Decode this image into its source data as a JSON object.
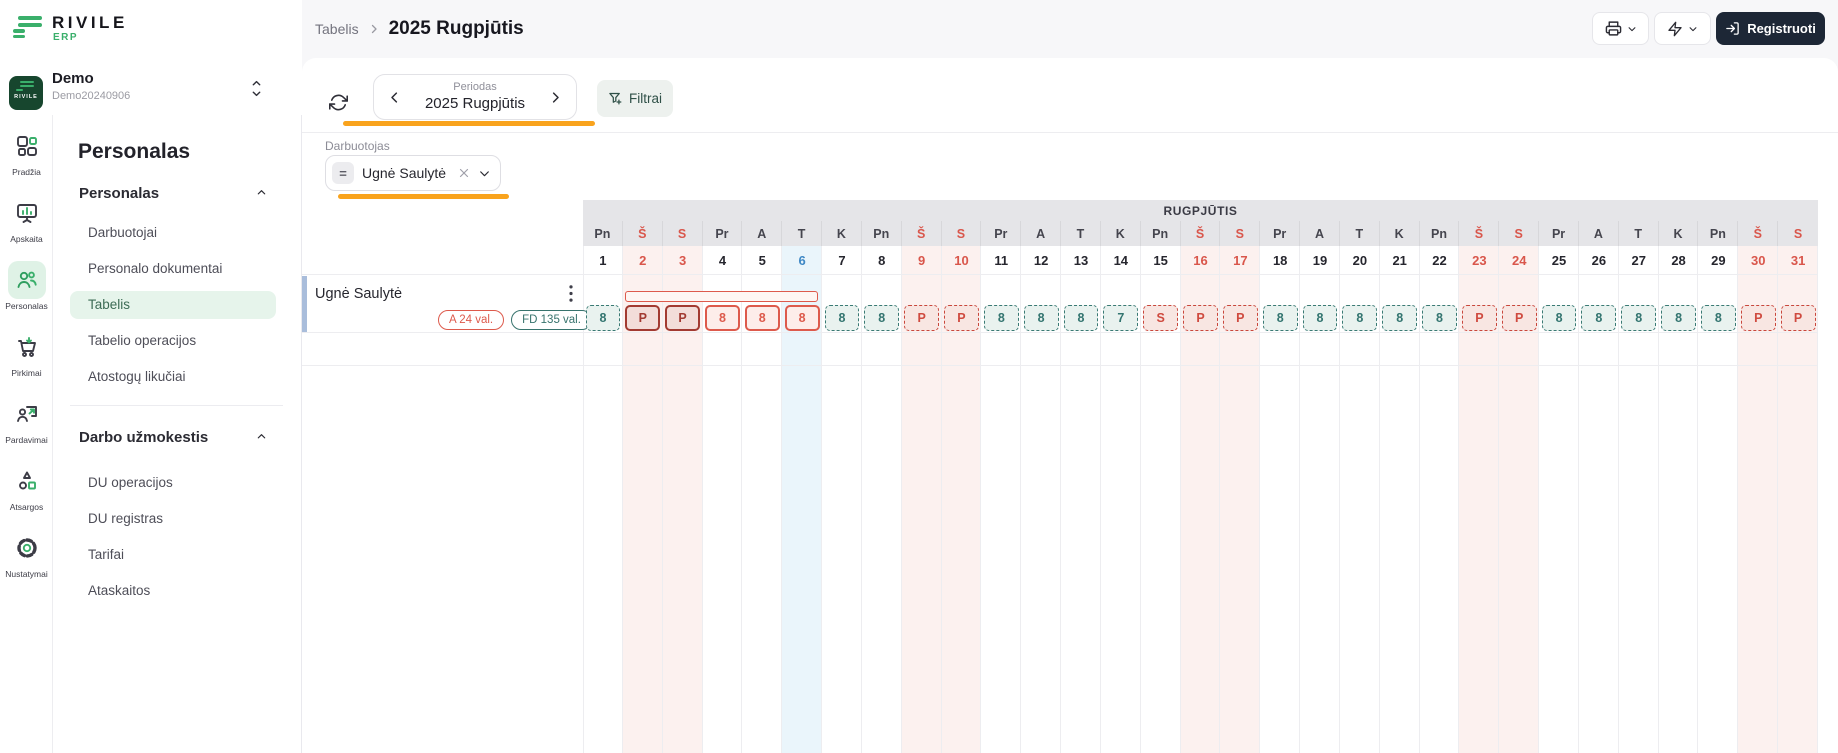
{
  "brand": {
    "name": "RIVILE",
    "tagline": "ERP"
  },
  "workspace": {
    "name": "Demo",
    "code": "Demo20240906"
  },
  "nav_rail": {
    "items": [
      {
        "label": "Pradžia",
        "active": false
      },
      {
        "label": "Apskaita",
        "active": false
      },
      {
        "label": "Personalas",
        "active": true
      },
      {
        "label": "Pirkimai",
        "active": false
      },
      {
        "label": "Pardavimai",
        "active": false
      },
      {
        "label": "Atsargos",
        "active": false
      },
      {
        "label": "Nustatymai",
        "active": false
      }
    ]
  },
  "sidebar": {
    "title": "Personalas",
    "sections": [
      {
        "label": "Personalas",
        "items": [
          {
            "label": "Darbuotojai",
            "active": false
          },
          {
            "label": "Personalo dokumentai",
            "active": false
          },
          {
            "label": "Tabelis",
            "active": true
          },
          {
            "label": "Tabelio operacijos",
            "active": false
          },
          {
            "label": "Atostogų likučiai",
            "active": false
          }
        ]
      },
      {
        "label": "Darbo užmokestis",
        "items": [
          {
            "label": "DU operacijos",
            "active": false
          },
          {
            "label": "DU registras",
            "active": false
          },
          {
            "label": "Tarifai",
            "active": false
          },
          {
            "label": "Ataskaitos",
            "active": false
          }
        ]
      }
    ]
  },
  "topbar": {
    "breadcrumb_parent": "Tabelis",
    "breadcrumb_current": "2025 Rugpjūtis",
    "register_label": "Registruoti"
  },
  "toolbar": {
    "period_label": "Periodas",
    "period_value": "2025 Rugpjūtis",
    "filter_button": "Filtrai"
  },
  "employee_filter": {
    "label": "Darbuotojas",
    "value": "Ugnė Saulytė"
  },
  "timesheet": {
    "month_title": "RUGPJŪTIS",
    "employee": {
      "name": "Ugnė Saulytė",
      "badges": [
        {
          "label": "A 24 val.",
          "style": "red"
        },
        {
          "label": "FD 135 val.",
          "style": "teal"
        }
      ]
    },
    "selection": {
      "from_day": 2,
      "to_day": 6
    },
    "days": [
      {
        "day": 1,
        "dow": "Pn",
        "kind": "work",
        "value": "8",
        "cell": "teal"
      },
      {
        "day": 2,
        "dow": "Š",
        "kind": "weekend",
        "value": "P",
        "cell": "seldark"
      },
      {
        "day": 3,
        "dow": "S",
        "kind": "weekend",
        "value": "P",
        "cell": "seldark"
      },
      {
        "day": 4,
        "dow": "Pr",
        "kind": "work",
        "value": "8",
        "cell": "sel"
      },
      {
        "day": 5,
        "dow": "A",
        "kind": "work",
        "value": "8",
        "cell": "sel"
      },
      {
        "day": 6,
        "dow": "T",
        "kind": "today",
        "value": "8",
        "cell": "sel"
      },
      {
        "day": 7,
        "dow": "K",
        "kind": "work",
        "value": "8",
        "cell": "teal"
      },
      {
        "day": 8,
        "dow": "Pn",
        "kind": "work",
        "value": "8",
        "cell": "teal"
      },
      {
        "day": 9,
        "dow": "Š",
        "kind": "weekend",
        "value": "P",
        "cell": "red"
      },
      {
        "day": 10,
        "dow": "S",
        "kind": "weekend",
        "value": "P",
        "cell": "red"
      },
      {
        "day": 11,
        "dow": "Pr",
        "kind": "work",
        "value": "8",
        "cell": "teal"
      },
      {
        "day": 12,
        "dow": "A",
        "kind": "work",
        "value": "8",
        "cell": "teal"
      },
      {
        "day": 13,
        "dow": "T",
        "kind": "work",
        "value": "8",
        "cell": "teal"
      },
      {
        "day": 14,
        "dow": "K",
        "kind": "work",
        "value": "7",
        "cell": "teal"
      },
      {
        "day": 15,
        "dow": "Pn",
        "kind": "work",
        "value": "S",
        "cell": "red"
      },
      {
        "day": 16,
        "dow": "Š",
        "kind": "weekend",
        "value": "P",
        "cell": "red"
      },
      {
        "day": 17,
        "dow": "S",
        "kind": "weekend",
        "value": "P",
        "cell": "red"
      },
      {
        "day": 18,
        "dow": "Pr",
        "kind": "work",
        "value": "8",
        "cell": "teal"
      },
      {
        "day": 19,
        "dow": "A",
        "kind": "work",
        "value": "8",
        "cell": "teal"
      },
      {
        "day": 20,
        "dow": "T",
        "kind": "work",
        "value": "8",
        "cell": "teal"
      },
      {
        "day": 21,
        "dow": "K",
        "kind": "work",
        "value": "8",
        "cell": "teal"
      },
      {
        "day": 22,
        "dow": "Pn",
        "kind": "work",
        "value": "8",
        "cell": "teal"
      },
      {
        "day": 23,
        "dow": "Š",
        "kind": "weekend",
        "value": "P",
        "cell": "red"
      },
      {
        "day": 24,
        "dow": "S",
        "kind": "weekend",
        "value": "P",
        "cell": "red"
      },
      {
        "day": 25,
        "dow": "Pr",
        "kind": "work",
        "value": "8",
        "cell": "teal"
      },
      {
        "day": 26,
        "dow": "A",
        "kind": "work",
        "value": "8",
        "cell": "teal"
      },
      {
        "day": 27,
        "dow": "T",
        "kind": "work",
        "value": "8",
        "cell": "teal"
      },
      {
        "day": 28,
        "dow": "K",
        "kind": "work",
        "value": "8",
        "cell": "teal"
      },
      {
        "day": 29,
        "dow": "Pn",
        "kind": "work",
        "value": "8",
        "cell": "teal"
      },
      {
        "day": 30,
        "dow": "Š",
        "kind": "weekend",
        "value": "P",
        "cell": "red"
      },
      {
        "day": 31,
        "dow": "S",
        "kind": "weekend",
        "value": "P",
        "cell": "red"
      }
    ]
  },
  "icons": {
    "logo_menu": "green-bars",
    "workspace_switcher": "chevron-up-down",
    "print": "printer",
    "quick_actions": "lightning-bolt",
    "register": "log-in",
    "refresh": "circular-arrows",
    "period_prev": "chevron-left",
    "period_next": "chevron-right",
    "filter": "funnel-plus",
    "chip_handle": "equals",
    "chip_clear": "x",
    "chip_dropdown": "chevron-down",
    "row_menu": "dots-vertical"
  },
  "colors": {
    "brand_green": "#3aaf6b",
    "accent_orange": "#f9a31d",
    "navy_button": "#1d2736",
    "teal_cell": "#337570",
    "red_cell": "#cf4a3f",
    "dark_red_selected": "#a23a31",
    "weekend_text": "#d9564b",
    "today_blue": "#3f88c5",
    "weekend_column": "#fcf1ef",
    "today_column": "#eaf5fb"
  }
}
